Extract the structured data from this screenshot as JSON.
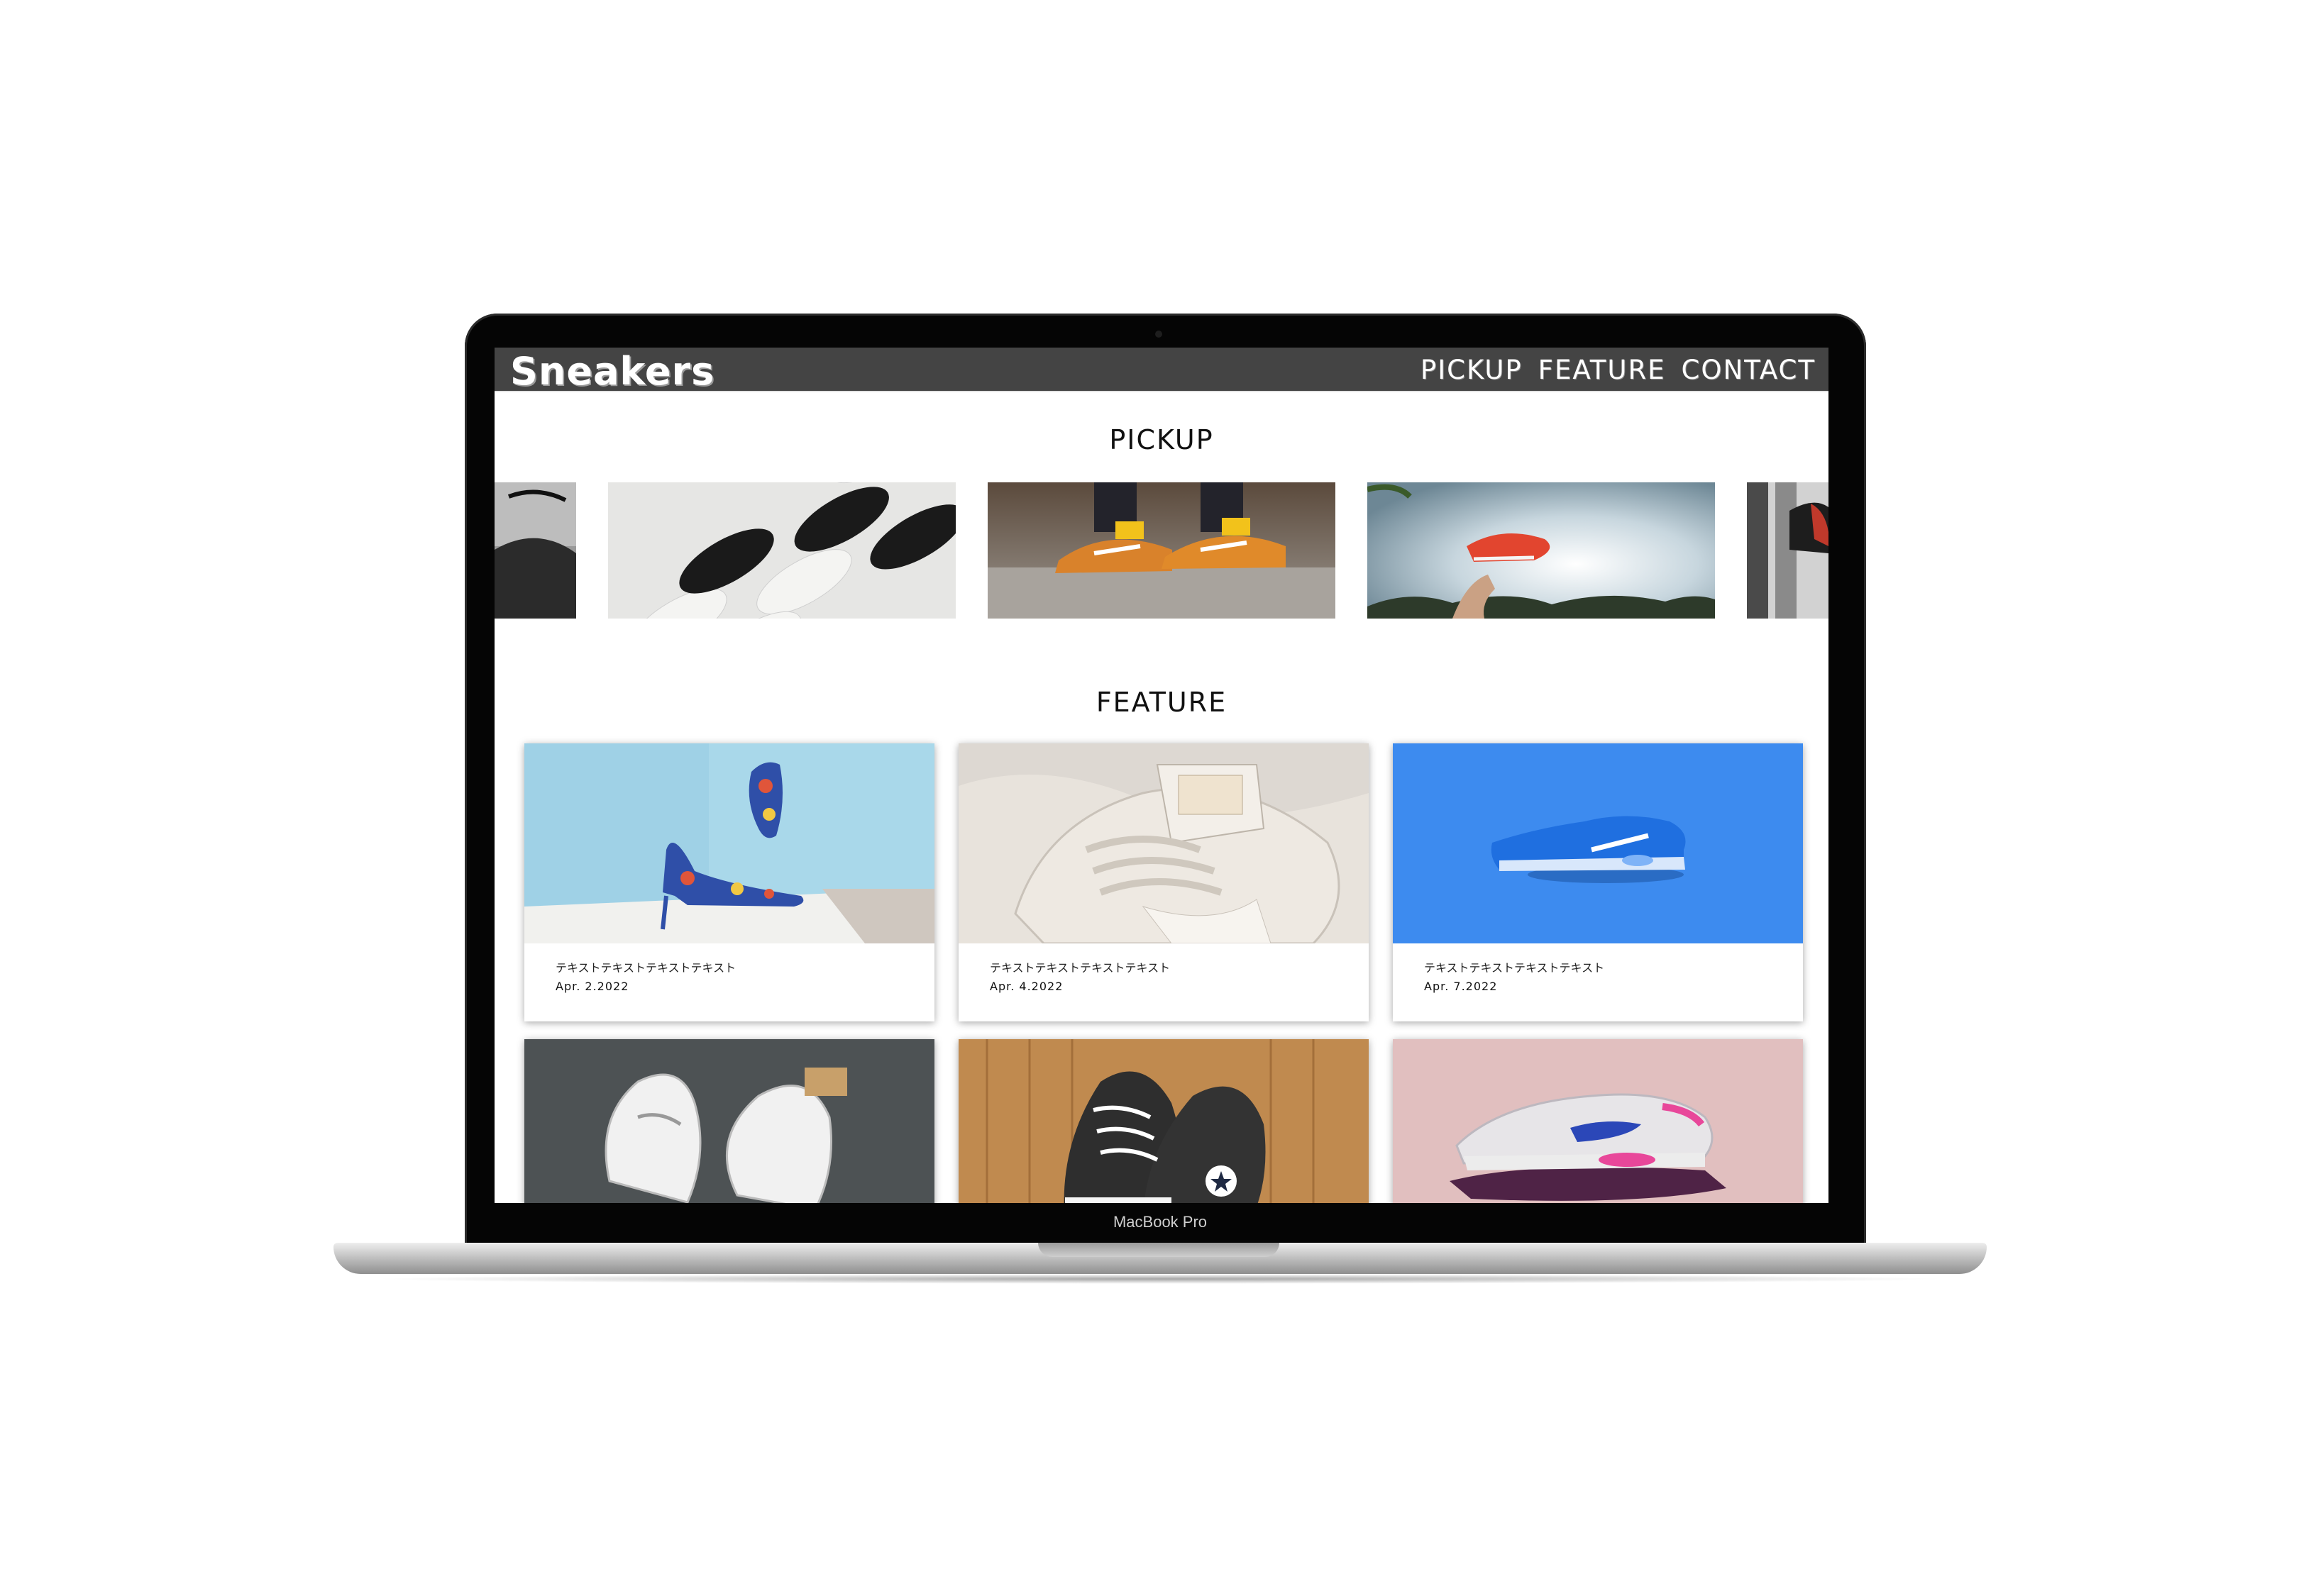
{
  "device": {
    "model_label": "MacBook Pro"
  },
  "site": {
    "logo": "Sneakers",
    "nav": [
      "PICKUP",
      "FEATURE",
      "CONTACT"
    ]
  },
  "pickup": {
    "title": "PICKUP",
    "images": [
      {
        "icon": "sneaker-photo-partial-left"
      },
      {
        "icon": "sneakers-flatlay-photo"
      },
      {
        "icon": "orange-sneakers-on-curb-photo"
      },
      {
        "icon": "sneaker-in-sky-photo"
      },
      {
        "icon": "sneaker-photo-partial-right"
      }
    ]
  },
  "feature": {
    "title": "FEATURE",
    "cards": [
      {
        "title": "テキストテキストテキストテキスト",
        "date": "Apr. 2.2022",
        "icon": "floral-heels-photo"
      },
      {
        "title": "テキストテキストテキストテキスト",
        "date": "Apr. 4.2022",
        "icon": "white-sneaker-closeup-photo"
      },
      {
        "title": "テキストテキストテキストテキスト",
        "date": "Apr. 7.2022",
        "icon": "blue-sneaker-photo"
      },
      {
        "icon": "white-hightops-photo"
      },
      {
        "icon": "converse-photo"
      },
      {
        "icon": "pink-sneaker-photo"
      }
    ]
  }
}
